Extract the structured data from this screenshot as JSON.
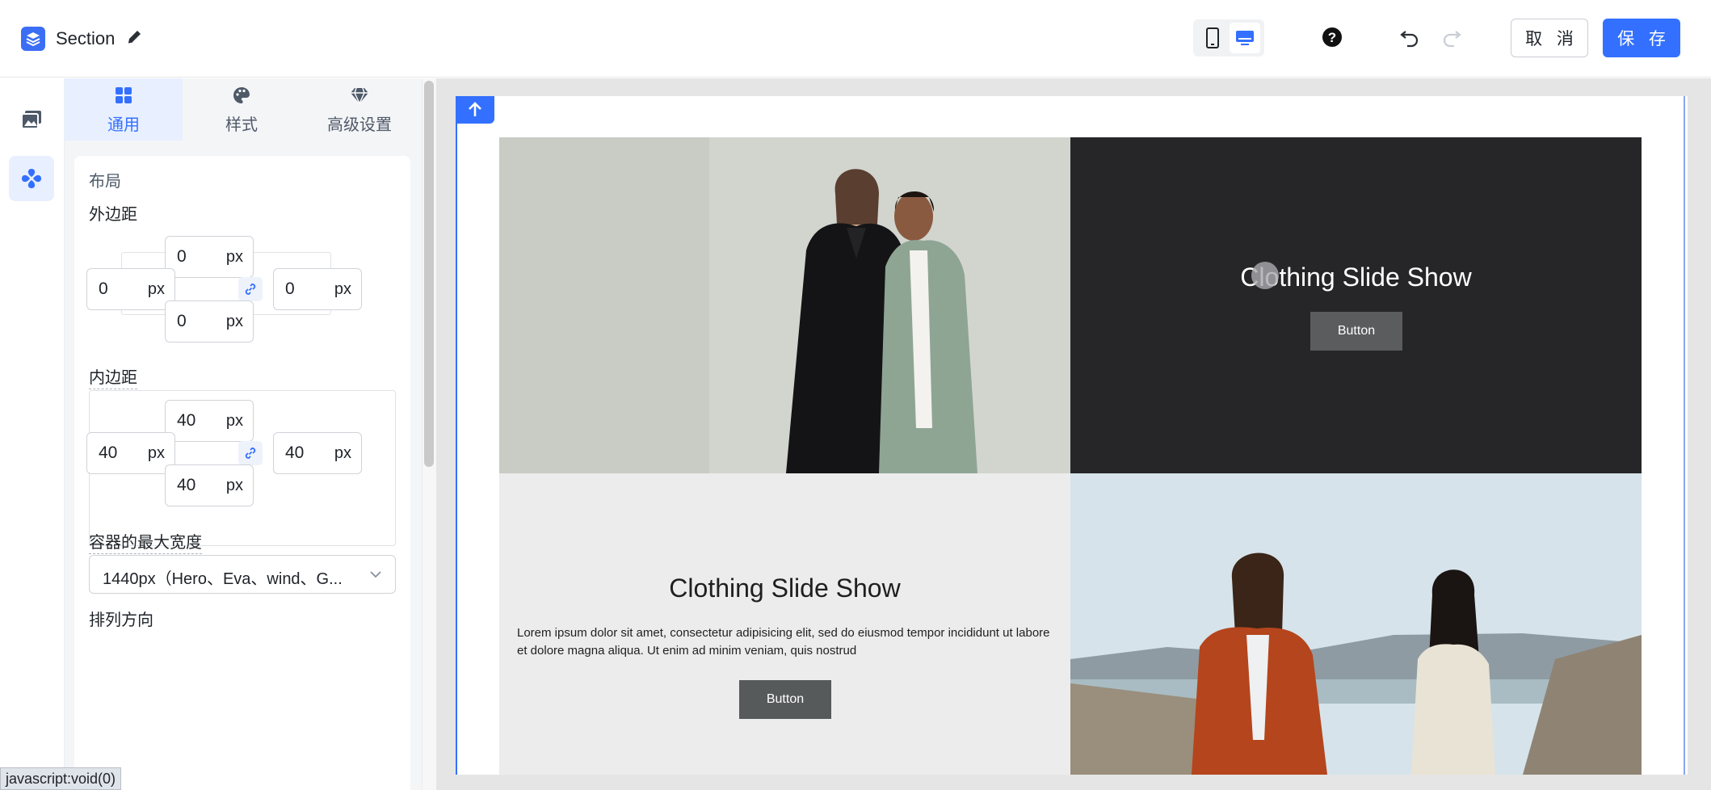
{
  "header": {
    "title": "Section",
    "cancel_label": "取 消",
    "save_label": "保 存",
    "accent_color": "#3370ff"
  },
  "rail": {
    "items": [
      {
        "icon": "media-library-icon"
      },
      {
        "icon": "components-icon",
        "active": true
      }
    ]
  },
  "panel": {
    "tabs": [
      {
        "label": "通用",
        "icon": "grid-icon",
        "active": true
      },
      {
        "label": "样式",
        "icon": "palette-icon"
      },
      {
        "label": "高级设置",
        "icon": "diamond-icon"
      }
    ],
    "layout_title": "布局",
    "margin": {
      "label": "外边距",
      "top": "0",
      "right": "0",
      "bottom": "0",
      "left": "0",
      "unit": "px"
    },
    "padding": {
      "label": "内边距",
      "top": "40",
      "right": "40",
      "bottom": "40",
      "left": "40",
      "unit": "px"
    },
    "max_width": {
      "label": "容器的最大宽度",
      "value": "1440px（Hero、Eva、wind、G..."
    },
    "next_label": "排列方向"
  },
  "status_tip": "javascript:void(0)",
  "canvas": {
    "block1": {
      "title": "Clothing Slide Show",
      "button": "Button"
    },
    "block2": {
      "title": "Clothing Slide Show",
      "text": "Lorem ipsum dolor sit amet, consectetur adipisicing elit, sed do eiusmod tempor incididunt ut labore et dolore magna aliqua. Ut enim ad minim veniam, quis nostrud",
      "button": "Button"
    }
  }
}
